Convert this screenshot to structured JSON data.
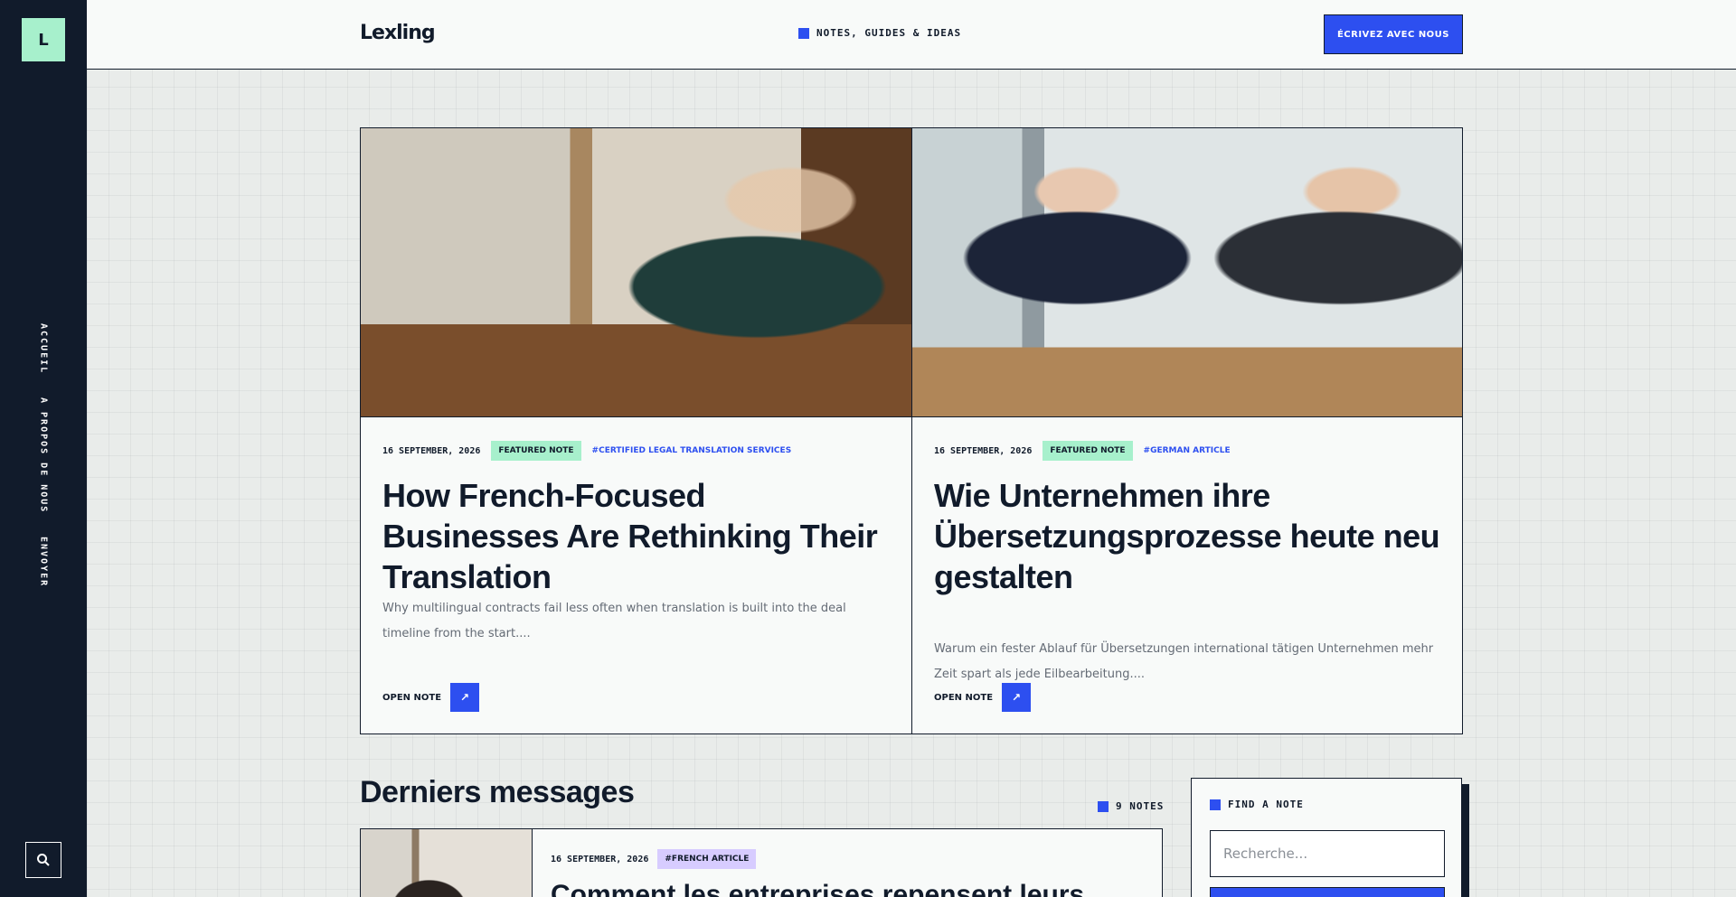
{
  "sidebar": {
    "logo_letter": "L",
    "nav": [
      "ACCUEIL",
      "A PROPOS DE NOUS",
      "ENVOYER"
    ]
  },
  "header": {
    "brand": "Lexling",
    "tagline": "NOTES, GUIDES & IDEAS",
    "cta": "ÉCRIVEZ AVEC NOUS"
  },
  "featured": [
    {
      "date": "16 SEPTEMBER, 2026",
      "badge": "FEATURED NOTE",
      "tag": "#CERTIFIED LEGAL TRANSLATION SERVICES",
      "title": "How French-Focused Businesses Are Rethinking Their Translation",
      "excerpt": "Why multilingual contracts fail less often when translation is built into the deal timeline from the start....",
      "cta": "OPEN NOTE"
    },
    {
      "date": "16 SEPTEMBER, 2026",
      "badge": "FEATURED NOTE",
      "tag": "#GERMAN ARTICLE",
      "title": "Wie Unternehmen ihre Übersetzungsprozesse heute neu gestalten",
      "excerpt": "Warum ein fester Ablauf für Übersetzungen international tätigen Unternehmen mehr Zeit spart als jede Eilbearbeitung....",
      "cta": "OPEN NOTE"
    }
  ],
  "latest": {
    "title": "Derniers messages",
    "count": "9 NOTES",
    "items": [
      {
        "date": "16 SEPTEMBER, 2026",
        "tag": "#FRENCH ARTICLE",
        "title": "Comment les entreprises repensent leurs"
      }
    ]
  },
  "search_widget": {
    "title": "FIND A NOTE",
    "placeholder": "Recherche..."
  },
  "colors": {
    "accent": "#2d4ff0",
    "sidebar": "#111b2b",
    "mint": "#a7f0cc",
    "lavender": "#d7ccff"
  }
}
